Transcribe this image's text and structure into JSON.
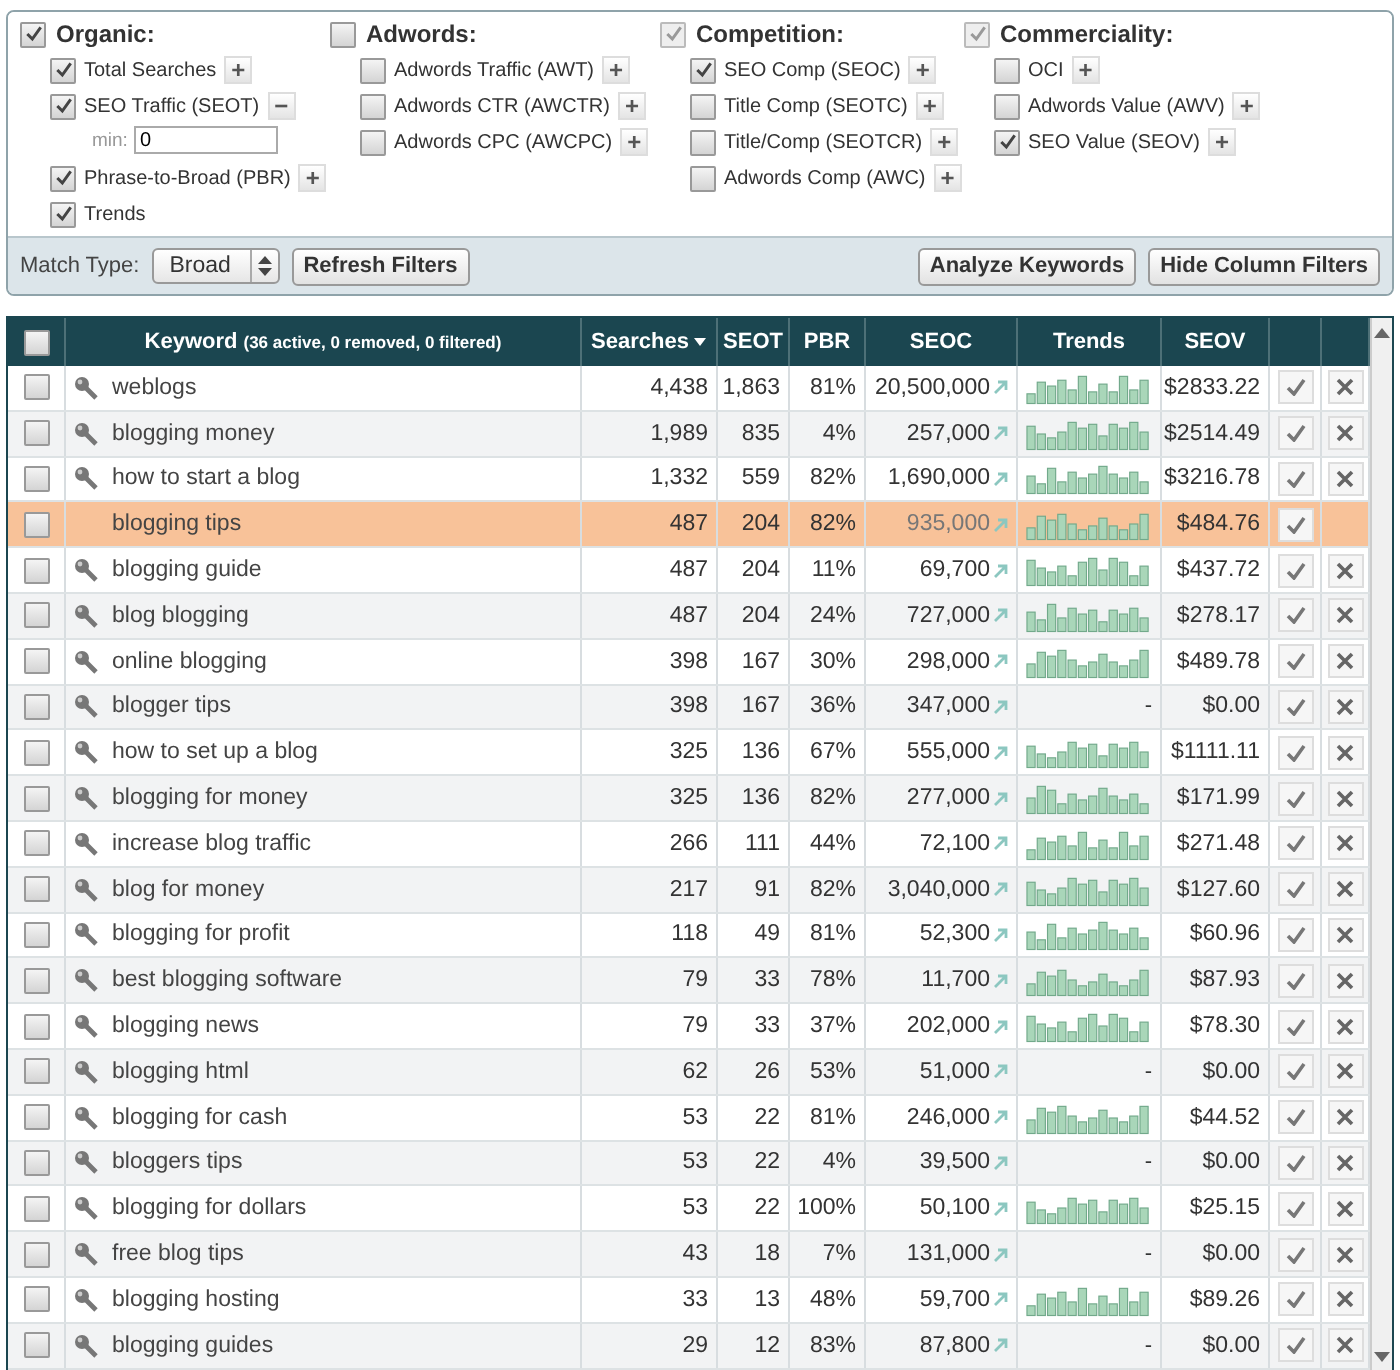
{
  "filters": {
    "groups": [
      {
        "label": "Organic:",
        "checked": true,
        "disabled": false,
        "items": [
          {
            "label": "Total Searches",
            "checked": true,
            "button": "+"
          },
          {
            "label": "SEO Traffic (SEOT)",
            "checked": true,
            "button": "−",
            "min_field": {
              "label": "min:",
              "value": "0"
            }
          },
          {
            "label": "Phrase-to-Broad (PBR)",
            "checked": true,
            "button": "+"
          },
          {
            "label": "Trends",
            "checked": true
          }
        ]
      },
      {
        "label": "Adwords:",
        "checked": false,
        "disabled": false,
        "items": [
          {
            "label": "Adwords Traffic (AWT)",
            "checked": false,
            "button": "+"
          },
          {
            "label": "Adwords CTR (AWCTR)",
            "checked": false,
            "button": "+"
          },
          {
            "label": "Adwords CPC (AWCPC)",
            "checked": false,
            "button": "+"
          }
        ]
      },
      {
        "label": "Competition:",
        "checked": true,
        "disabled": true,
        "items": [
          {
            "label": "SEO Comp (SEOC)",
            "checked": true,
            "button": "+"
          },
          {
            "label": "Title Comp (SEOTC)",
            "checked": false,
            "button": "+"
          },
          {
            "label": "Title/Comp (SEOTCR)",
            "checked": false,
            "button": "+"
          },
          {
            "label": "Adwords Comp (AWC)",
            "checked": false,
            "button": "+"
          }
        ]
      },
      {
        "label": "Commerciality:",
        "checked": true,
        "disabled": true,
        "items": [
          {
            "label": "OCI",
            "checked": false,
            "button": "+"
          },
          {
            "label": "Adwords Value (AWV)",
            "checked": false,
            "button": "+"
          },
          {
            "label": "SEO Value (SEOV)",
            "checked": true,
            "button": "+"
          }
        ]
      }
    ],
    "match_type": {
      "label": "Match Type:",
      "value": "Broad"
    },
    "refresh_button": "Refresh Filters",
    "action_buttons": [
      "Analyze Keywords",
      "Hide Column Filters"
    ]
  },
  "table": {
    "header_checked": false,
    "columns": [
      {
        "label": "Keyword",
        "note": "(36 active, 0 removed, 0 filtered)",
        "sorted": false
      },
      {
        "label": "Searches",
        "sorted": true
      },
      {
        "label": "SEOT",
        "sorted": false
      },
      {
        "label": "PBR",
        "sorted": false
      },
      {
        "label": "SEOC",
        "sorted": false
      },
      {
        "label": "Trends",
        "sorted": false
      },
      {
        "label": "SEOV",
        "sorted": false
      }
    ],
    "rows": [
      {
        "keyword": "weblogs",
        "searches": "4,438",
        "seot": "1,863",
        "pbr": "81%",
        "seoc": "20,500,000",
        "seov": "$2833.22",
        "checked": false,
        "selected": false
      },
      {
        "keyword": "blogging money",
        "searches": "1,989",
        "seot": "835",
        "pbr": "4%",
        "seoc": "257,000",
        "seov": "$2514.49",
        "checked": false,
        "selected": false
      },
      {
        "keyword": "how to start a blog",
        "searches": "1,332",
        "seot": "559",
        "pbr": "82%",
        "seoc": "1,690,000",
        "seov": "$3216.78",
        "checked": false,
        "selected": false
      },
      {
        "keyword": "blogging tips",
        "searches": "487",
        "seot": "204",
        "pbr": "82%",
        "seoc": "935,000",
        "seov": "$484.76",
        "checked": false,
        "selected": true
      },
      {
        "keyword": "blogging guide",
        "searches": "487",
        "seot": "204",
        "pbr": "11%",
        "seoc": "69,700",
        "seov": "$437.72",
        "checked": false,
        "selected": false
      },
      {
        "keyword": "blog blogging",
        "searches": "487",
        "seot": "204",
        "pbr": "24%",
        "seoc": "727,000",
        "seov": "$278.17",
        "checked": false,
        "selected": false
      },
      {
        "keyword": "online blogging",
        "searches": "398",
        "seot": "167",
        "pbr": "30%",
        "seoc": "298,000",
        "seov": "$489.78",
        "checked": false,
        "selected": false
      },
      {
        "keyword": "blogger tips",
        "searches": "398",
        "seot": "167",
        "pbr": "36%",
        "seoc": "347,000",
        "trend_text": "-",
        "seov": "$0.00",
        "checked": false,
        "selected": false
      },
      {
        "keyword": "how to set up a blog",
        "searches": "325",
        "seot": "136",
        "pbr": "67%",
        "seoc": "555,000",
        "seov": "$1111.11",
        "checked": false,
        "selected": false
      },
      {
        "keyword": "blogging for money",
        "searches": "325",
        "seot": "136",
        "pbr": "82%",
        "seoc": "277,000",
        "seov": "$171.99",
        "checked": false,
        "selected": false
      },
      {
        "keyword": "increase blog traffic",
        "searches": "266",
        "seot": "111",
        "pbr": "44%",
        "seoc": "72,100",
        "seov": "$271.48",
        "checked": false,
        "selected": false
      },
      {
        "keyword": "blog for money",
        "searches": "217",
        "seot": "91",
        "pbr": "82%",
        "seoc": "3,040,000",
        "seov": "$127.60",
        "checked": false,
        "selected": false
      },
      {
        "keyword": "blogging for profit",
        "searches": "118",
        "seot": "49",
        "pbr": "81%",
        "seoc": "52,300",
        "seov": "$60.96",
        "checked": false,
        "selected": false
      },
      {
        "keyword": "best blogging software",
        "searches": "79",
        "seot": "33",
        "pbr": "78%",
        "seoc": "11,700",
        "seov": "$87.93",
        "checked": false,
        "selected": false
      },
      {
        "keyword": "blogging news",
        "searches": "79",
        "seot": "33",
        "pbr": "37%",
        "seoc": "202,000",
        "seov": "$78.30",
        "checked": false,
        "selected": false
      },
      {
        "keyword": "blogging html",
        "searches": "62",
        "seot": "26",
        "pbr": "53%",
        "seoc": "51,000",
        "trend_text": "-",
        "seov": "$0.00",
        "checked": false,
        "selected": false
      },
      {
        "keyword": "blogging for cash",
        "searches": "53",
        "seot": "22",
        "pbr": "81%",
        "seoc": "246,000",
        "seov": "$44.52",
        "checked": false,
        "selected": false
      },
      {
        "keyword": "bloggers tips",
        "searches": "53",
        "seot": "22",
        "pbr": "4%",
        "seoc": "39,500",
        "trend_text": "-",
        "seov": "$0.00",
        "checked": false,
        "selected": false
      },
      {
        "keyword": "blogging for dollars",
        "searches": "53",
        "seot": "22",
        "pbr": "100%",
        "seoc": "50,100",
        "seov": "$25.15",
        "checked": false,
        "selected": false
      },
      {
        "keyword": "free blog tips",
        "searches": "43",
        "seot": "18",
        "pbr": "7%",
        "seoc": "131,000",
        "trend_text": "-",
        "seov": "$0.00",
        "checked": false,
        "selected": false
      },
      {
        "keyword": "blogging hosting",
        "searches": "33",
        "seot": "13",
        "pbr": "48%",
        "seoc": "59,700",
        "seov": "$89.26",
        "checked": false,
        "selected": false
      },
      {
        "keyword": "blogging guides",
        "searches": "29",
        "seot": "12",
        "pbr": "83%",
        "seoc": "87,800",
        "trend_text": "-",
        "seov": "$0.00",
        "checked": false,
        "selected": false
      }
    ]
  }
}
